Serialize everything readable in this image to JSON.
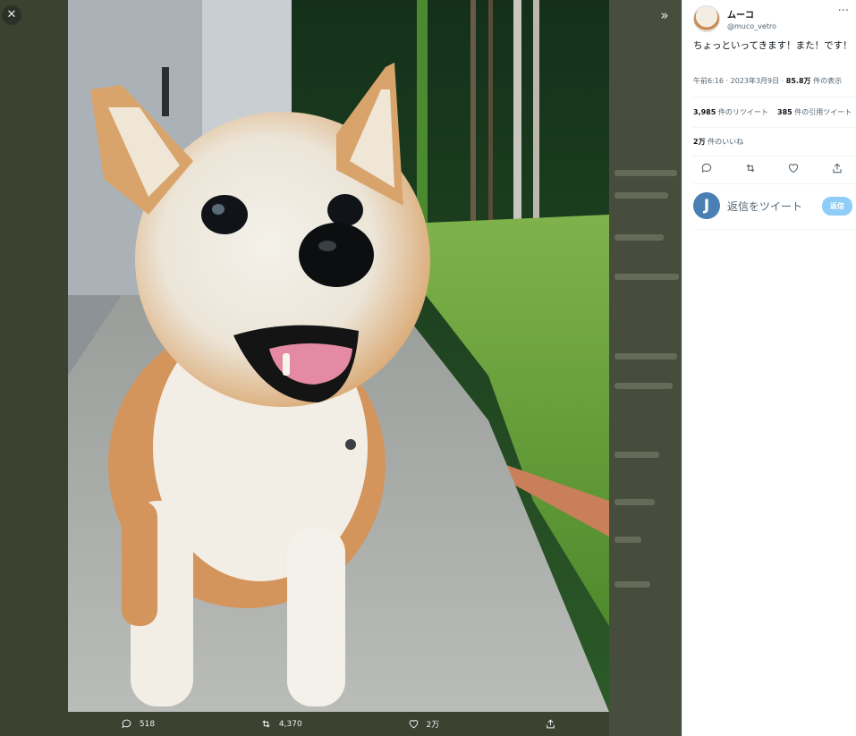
{
  "viewer": {
    "close_icon": "✕",
    "collapse_icon": "»",
    "actions": {
      "replies": "518",
      "retweets": "4,370",
      "likes": "2万"
    }
  },
  "tweet": {
    "author_name": "ムーコ",
    "author_handle": "@muco_vetro",
    "more_icon": "···",
    "text": "ちょっといってきます！また！です！",
    "time": "午前6:16",
    "date": "2023年3月9日",
    "views_count": "85.8万",
    "views_label": "件の表示",
    "retweets_count": "3,985",
    "retweets_label": "件のリツイート",
    "quotes_count": "385",
    "quotes_label": "件の引用ツイート",
    "likes_count": "2万",
    "likes_label": "件のいいね"
  },
  "reply": {
    "avatar_letter": "J",
    "placeholder": "返信をツイート",
    "button": "返信"
  },
  "colors": {
    "viewer_bg": "#3b422f",
    "accent": "#1d9bf0",
    "reply_button": "#8ecdf7"
  }
}
